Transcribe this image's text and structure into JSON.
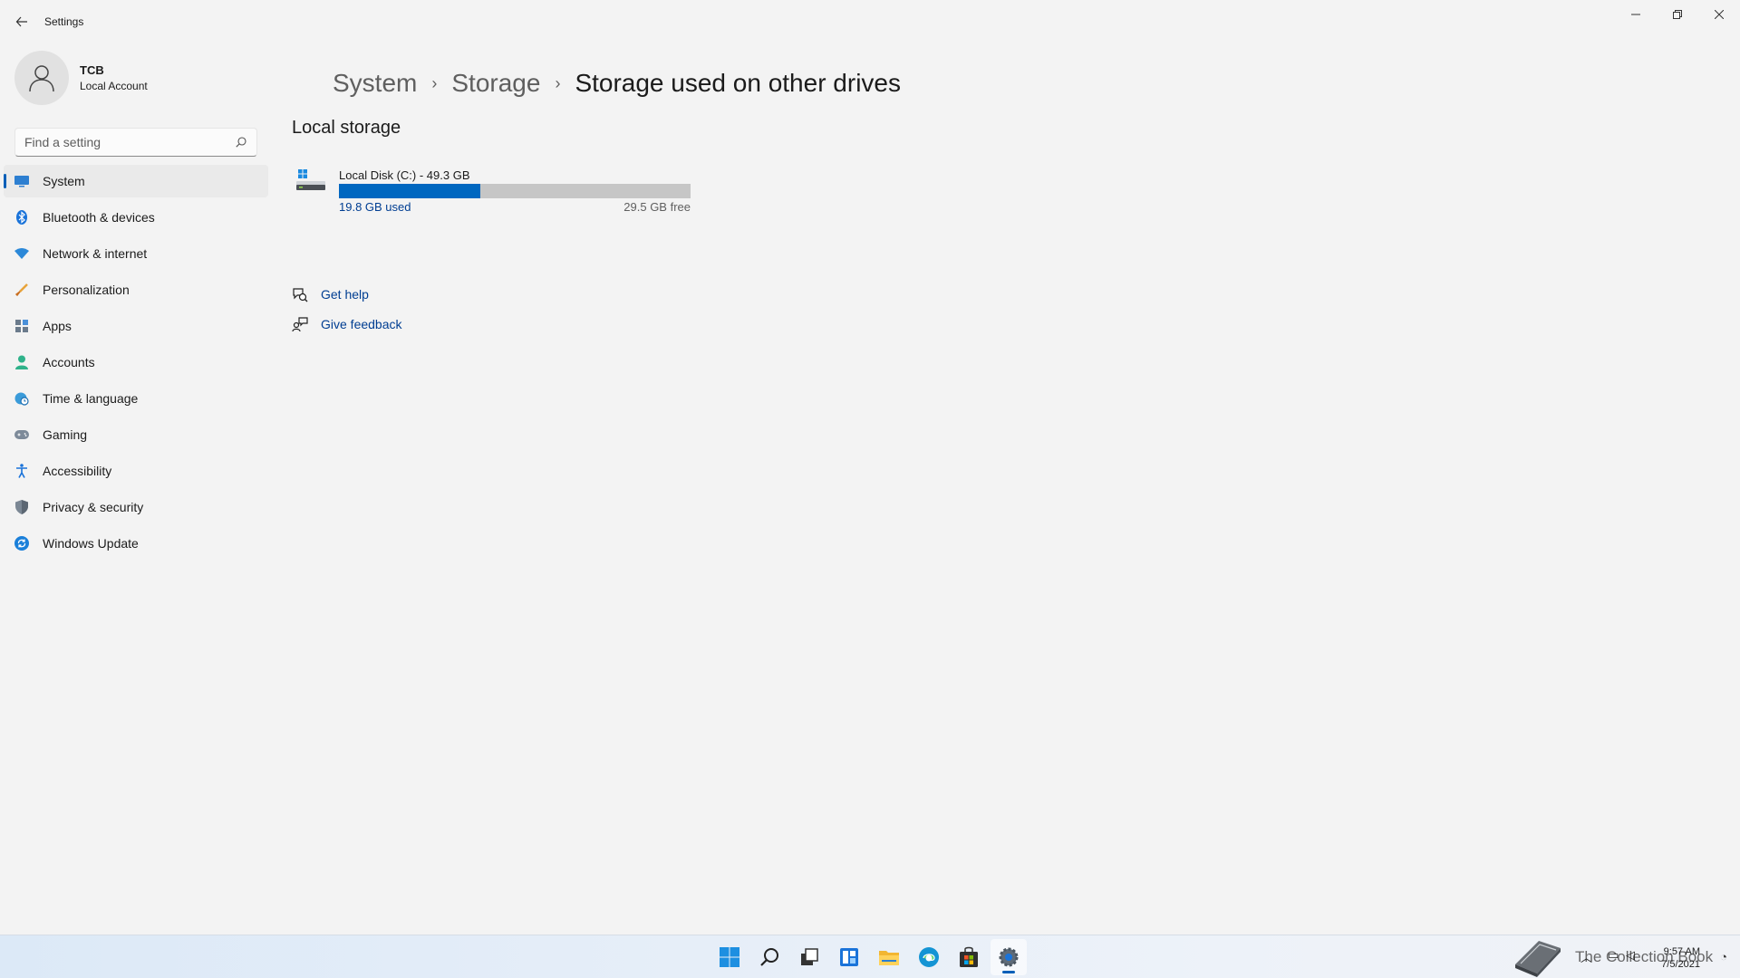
{
  "window": {
    "title": "Settings",
    "controls": {
      "minimize": "—",
      "restore": "❐",
      "close": "✕"
    }
  },
  "profile": {
    "name": "TCB",
    "account_type": "Local Account"
  },
  "search": {
    "placeholder": "Find a setting",
    "value": ""
  },
  "sidebar": {
    "items": [
      {
        "label": "System",
        "icon": "system-icon",
        "active": true
      },
      {
        "label": "Bluetooth & devices",
        "icon": "bluetooth-icon"
      },
      {
        "label": "Network & internet",
        "icon": "wifi-icon"
      },
      {
        "label": "Personalization",
        "icon": "brush-icon"
      },
      {
        "label": "Apps",
        "icon": "apps-icon"
      },
      {
        "label": "Accounts",
        "icon": "accounts-icon"
      },
      {
        "label": "Time & language",
        "icon": "globe-clock-icon"
      },
      {
        "label": "Gaming",
        "icon": "gamepad-icon"
      },
      {
        "label": "Accessibility",
        "icon": "accessibility-icon"
      },
      {
        "label": "Privacy & security",
        "icon": "shield-icon"
      },
      {
        "label": "Windows Update",
        "icon": "update-icon"
      }
    ]
  },
  "breadcrumb": {
    "items": [
      "System",
      "Storage",
      "Storage used on other drives"
    ],
    "separator": "›"
  },
  "local_storage": {
    "title": "Local storage",
    "drives": [
      {
        "name": "Local Disk (C:) - 49.3 GB",
        "used_label": "19.8 GB used",
        "free_label": "29.5 GB free",
        "used_fraction": 0.402
      }
    ]
  },
  "help": {
    "get_help": "Get help",
    "give_feedback": "Give feedback"
  },
  "taskbar": {
    "apps": [
      "start-icon",
      "search-icon",
      "task-view-icon",
      "widgets-icon",
      "file-explorer-icon",
      "edge-icon",
      "store-icon",
      "settings-icon"
    ],
    "watermark": "The Collection Book",
    "time": "9:57 AM",
    "date": "7/5/2021"
  },
  "colors": {
    "accent": "#005fb8",
    "bar_used": "#0067c0",
    "bar_free": "#c6c6c6",
    "link": "#003e92"
  }
}
